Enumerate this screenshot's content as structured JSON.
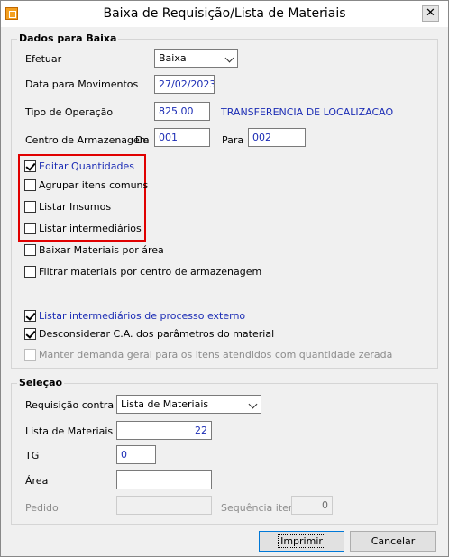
{
  "window": {
    "title": "Baixa de Requisição/Lista de Materiais",
    "close_glyph": "✕",
    "app_icon": "app-icon"
  },
  "dados": {
    "legend": "Dados para Baixa",
    "efetuar": {
      "label": "Efetuar",
      "value": "Baixa"
    },
    "data_mov": {
      "label": "Data para Movimentos",
      "value": "27/02/2023"
    },
    "tipo_op": {
      "label": "Tipo de Operação",
      "value": "825.00",
      "desc": "TRANSFERENCIA DE LOCALIZACAO"
    },
    "centro": {
      "label": "Centro de Armazenagem",
      "de_label": "De",
      "de_value": "001",
      "para_label": "Para",
      "para_value": "002"
    },
    "checkboxes": [
      {
        "label": "Editar Quantidades",
        "checked": true,
        "style": "blue"
      },
      {
        "label": "Agrupar itens comuns",
        "checked": false,
        "style": "normal"
      },
      {
        "label": "Listar Insumos",
        "checked": false,
        "style": "normal"
      },
      {
        "label": "Listar intermediários",
        "checked": false,
        "style": "normal"
      },
      {
        "label": "Baixar Materiais por área",
        "checked": false,
        "style": "normal"
      },
      {
        "label": "Filtrar materiais por centro de armazenagem",
        "checked": false,
        "style": "normal"
      },
      {
        "label": "Listar intermediários de processo externo",
        "checked": true,
        "style": "blue"
      },
      {
        "label": "Desconsiderar C.A. dos parâmetros do material",
        "checked": true,
        "style": "normal"
      },
      {
        "label": "Manter demanda geral para os itens atendidos com quantidade zerada",
        "checked": false,
        "style": "disabled"
      }
    ],
    "highlight_color": "#e00000"
  },
  "selecao": {
    "legend": "Seleção",
    "requisicao": {
      "label": "Requisição contra",
      "value": "Lista de Materiais"
    },
    "lista": {
      "label": "Lista de Materiais",
      "value": "22"
    },
    "tg": {
      "label": "TG",
      "value": "0"
    },
    "area": {
      "label": "Área",
      "value": ""
    },
    "pedido": {
      "label": "Pedido",
      "value": ""
    },
    "sequencia": {
      "label": "Sequência item",
      "value": "0"
    }
  },
  "buttons": {
    "imprimir": "Imprimir",
    "cancelar": "Cancelar"
  },
  "colors": {
    "accent_text": "#1c2db5",
    "disabled_text": "#8c8c8c",
    "dialog_bg": "#f0f0f0"
  }
}
